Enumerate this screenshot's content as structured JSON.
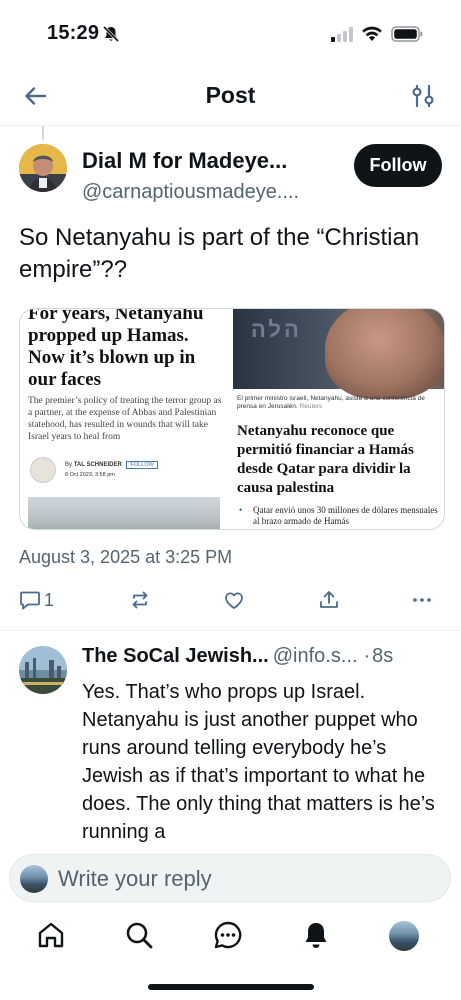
{
  "status_bar": {
    "time": "15:29"
  },
  "header": {
    "title": "Post"
  },
  "post": {
    "author_name": "Dial M for Madeye...",
    "author_handle": "@carnaptiousmadeye....",
    "follow_label": "Follow",
    "text": "So Netanyahu is part of the “Christian empire”??",
    "timestamp": "August 3, 2025 at 3:25 PM",
    "reply_count": "1",
    "media": {
      "left": {
        "headline": "For years, Netanyahu propped up Hamas. Now it’s blown up in our faces",
        "standfirst": "The premier’s policy of treating the terror group as a partner, at the expense of Abbas and Palestinian statehood, has resulted in wounds that will take Israel years to heal from",
        "byline_prefix": "By",
        "byline_author": "TAL SCHNEIDER",
        "byline_follow": "FOLLOW",
        "byline_date": "8 Oct 2023, 3:58 pm"
      },
      "right": {
        "sign_text": "הלה",
        "caption": "El primer ministro israelí, Netanyahu, asiste a una conferencia de prensa en Jerusalén.",
        "caption_credit": "Reuters",
        "headline": "Netanyahu reconoce que permitió financiar a Hamás desde Qatar para dividir la causa palestina",
        "bullet": "Qatar envió unos 30 millones de dólares mensuales al brazo armado de Hamás"
      }
    }
  },
  "reply": {
    "name": "The SoCal Jewish...",
    "handle": "@info.s...",
    "dot": "·",
    "time": "8s",
    "text": "Yes. That’s who props up Israel. Netanyahu is just another puppet who runs around telling everybody he’s Jewish as if that’s important to what he does. The only thing that matters is he’s running a"
  },
  "composer": {
    "placeholder": "Write your reply"
  },
  "colors": {
    "text_primary": "#0f1419",
    "text_secondary": "#536471",
    "accent": "#1d9bf0",
    "icon_secondary": "#536471",
    "follow_bg": "#0f1419"
  },
  "icons": {
    "back": "arrow-left-icon",
    "tune": "sliders-icon",
    "reply": "comment-icon",
    "repost": "repost-icon",
    "like": "heart-icon",
    "share": "share-icon",
    "more": "more-icon",
    "tabs": [
      "home-icon",
      "search-icon",
      "messages-icon",
      "notifications-icon",
      "profile-avatar"
    ]
  }
}
